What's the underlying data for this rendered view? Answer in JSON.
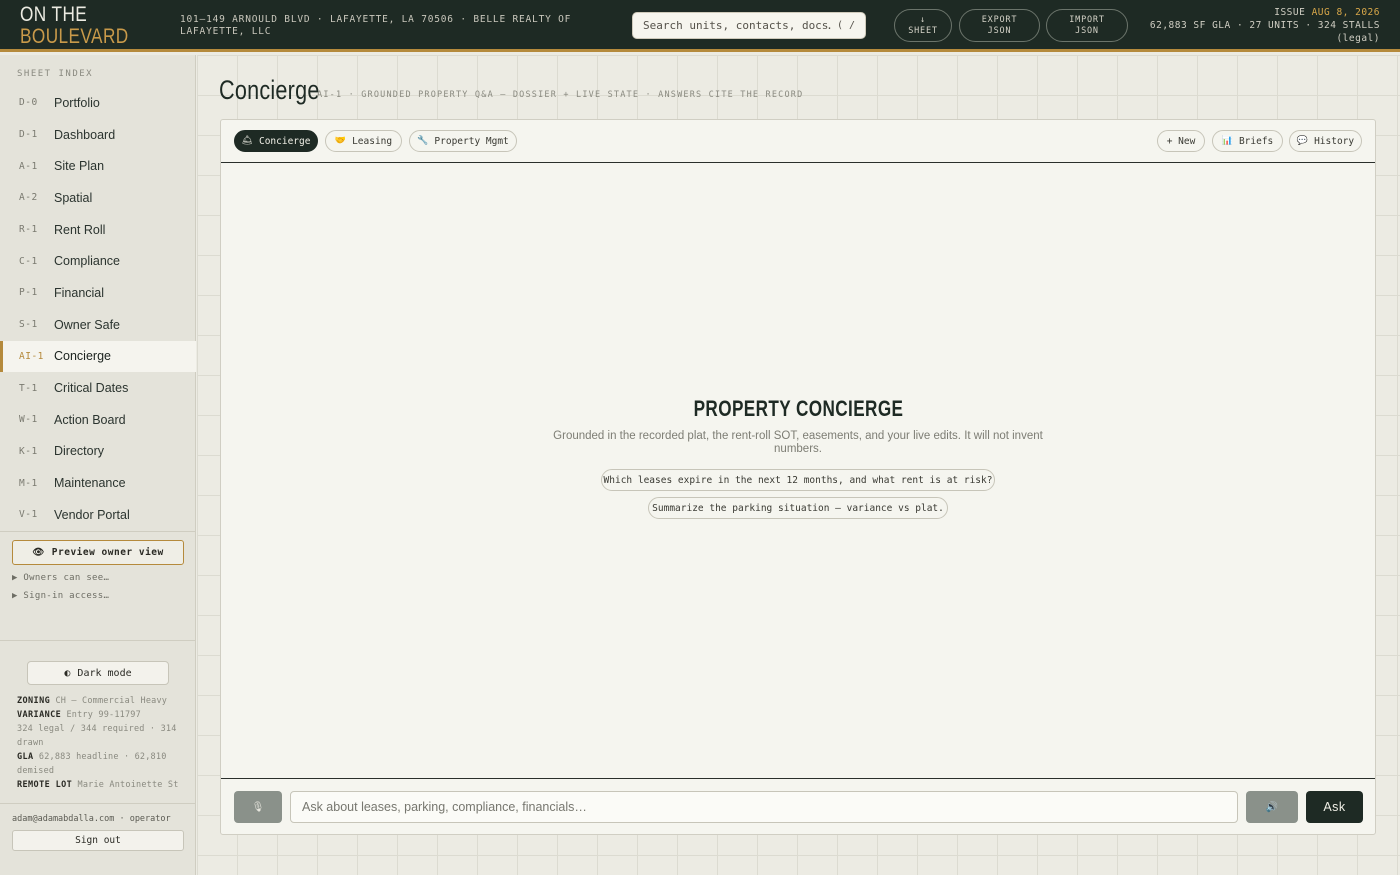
{
  "header": {
    "logo_line1": "ON THE",
    "logo_line2": "BOULEVARD",
    "address": "101–149 Arnould Blvd · Lafayette, LA 70506 · Belle Realty of Lafayette, LLC",
    "search_placeholder": "Search units, contacts, docs…",
    "search_shortcut": "( /",
    "buttons": {
      "sheet_line1": "↓",
      "sheet_line2": "Sheet",
      "export_line1": "Export",
      "export_line2": "JSON",
      "import_line1": "Import",
      "import_line2": "JSON"
    },
    "issue_label": "ISSUE",
    "issue_date": "AUG 8, 2026",
    "stats_line1": "62,883 SF GLA · 27 UNITS · 324 STALLS",
    "stats_line2": "(legal)"
  },
  "sidebar": {
    "heading": "SHEET INDEX",
    "items": [
      {
        "code": "D-0",
        "label": "Portfolio"
      },
      {
        "code": "D-1",
        "label": "Dashboard"
      },
      {
        "code": "A-1",
        "label": "Site Plan"
      },
      {
        "code": "A-2",
        "label": "Spatial"
      },
      {
        "code": "R-1",
        "label": "Rent Roll"
      },
      {
        "code": "C-1",
        "label": "Compliance"
      },
      {
        "code": "P-1",
        "label": "Financial"
      },
      {
        "code": "S-1",
        "label": "Owner Safe"
      },
      {
        "code": "AI-1",
        "label": "Concierge"
      },
      {
        "code": "T-1",
        "label": "Critical Dates"
      },
      {
        "code": "W-1",
        "label": "Action Board"
      },
      {
        "code": "K-1",
        "label": "Directory"
      },
      {
        "code": "M-1",
        "label": "Maintenance"
      },
      {
        "code": "V-1",
        "label": "Vendor Portal"
      }
    ],
    "active_index": 8,
    "preview_label": "Preview owner view",
    "disclosure1": "▶ Owners can see…",
    "disclosure2": "▶ Sign-in access…",
    "dark_mode_label": "Dark mode",
    "facts": {
      "zoning_key": "ZONING",
      "zoning_val": "CH — Commercial Heavy",
      "variance_key": "VARIANCE",
      "variance_val": "Entry 99-11797",
      "variance_detail": "324 legal / 344 required · 314 drawn",
      "gla_key": "GLA",
      "gla_val": "62,883 headline · 62,810 demised",
      "remote_key": "REMOTE LOT",
      "remote_val": "Marie Antoinette St"
    },
    "user": "adam@adamabdalla.com · operator",
    "signout_label": "Sign out"
  },
  "main": {
    "title": "Concierge",
    "subtitle": "AI-1 · Grounded property Q&A — dossier + live state · answers cite the record",
    "tabs": [
      {
        "icon": "🛎",
        "label": "Concierge"
      },
      {
        "icon": "🤝",
        "label": "Leasing"
      },
      {
        "icon": "🔧",
        "label": "Property Mgmt"
      }
    ],
    "actions": {
      "new_label": "+ New",
      "briefs_icon": "📊",
      "briefs_label": "Briefs",
      "history_icon": "💬",
      "history_label": "History"
    },
    "empty_title": "PROPERTY CONCIERGE",
    "empty_desc": "Grounded in the recorded plat, the rent-roll SOT, easements, and your live edits. It will not invent numbers.",
    "suggestions": [
      "Which leases expire in the next 12 months, and what rent is at risk?",
      "Summarize the parking situation — variance vs plat."
    ],
    "composer": {
      "mic_icon": "🎙",
      "placeholder": "Ask about leases, parking, compliance, financials…",
      "speak_icon": "🔊",
      "ask_label": "Ask"
    }
  }
}
